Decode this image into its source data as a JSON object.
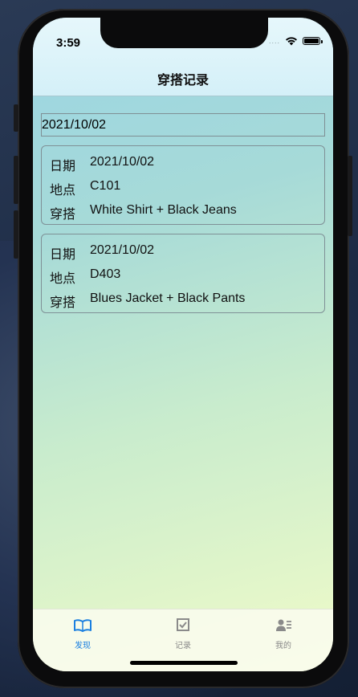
{
  "status": {
    "time": "3:59",
    "signal": "....",
    "battery_level": 1.0
  },
  "header": {
    "title": "穿搭记录"
  },
  "search": {
    "value": "2021/10/02"
  },
  "records": [
    {
      "date_label": "日期",
      "date": "2021/10/02",
      "location_label": "地点",
      "location": "C101",
      "outfit_label": "穿搭",
      "outfit": "White Shirt + Black Jeans"
    },
    {
      "date_label": "日期",
      "date": "2021/10/02",
      "location_label": "地点",
      "location": "D403",
      "outfit_label": "穿搭",
      "outfit": "Blues Jacket + Black Pants"
    }
  ],
  "tabbar": {
    "tabs": [
      {
        "label": "发现",
        "icon": "book-icon",
        "active": true
      },
      {
        "label": "记录",
        "icon": "checkbox-icon",
        "active": false
      },
      {
        "label": "我的",
        "icon": "profile-icon",
        "active": false
      }
    ],
    "active_color": "#1a7fe0",
    "inactive_color": "#8a8a8a"
  }
}
